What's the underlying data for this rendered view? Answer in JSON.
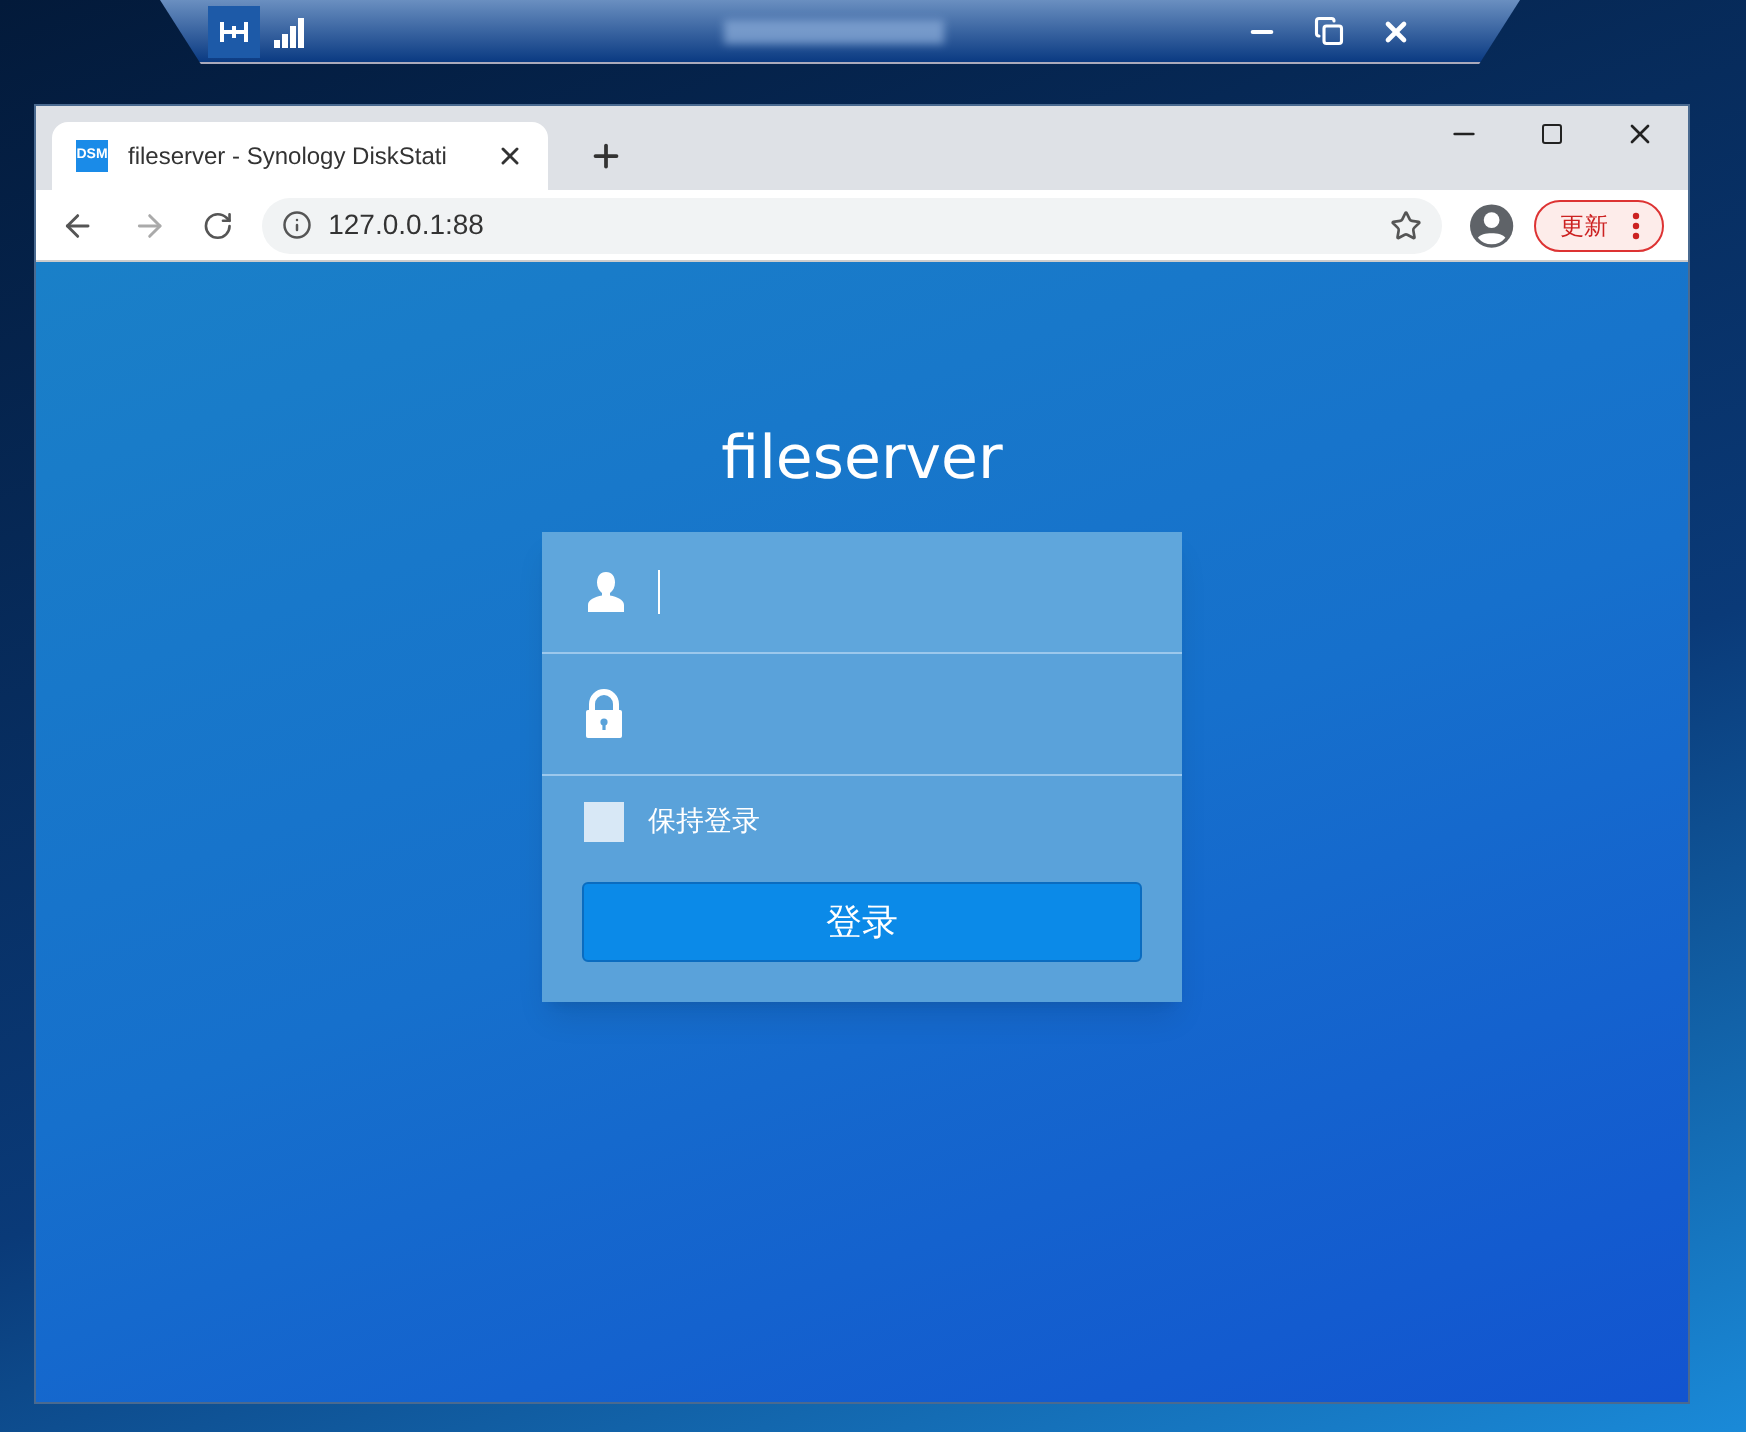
{
  "browser": {
    "tab": {
      "favicon": "DSM",
      "title": "fileserver - Synology DiskStati",
      "selected": true
    },
    "address": {
      "url": "127.0.0.1:88"
    },
    "update_button": "更新"
  },
  "login": {
    "title": "fileserver",
    "fields": [
      {
        "kind": "username",
        "focused": true
      },
      {
        "kind": "password",
        "focused": false
      }
    ],
    "remember": {
      "label": "保持登录",
      "checked": false
    },
    "submit": "登录"
  }
}
